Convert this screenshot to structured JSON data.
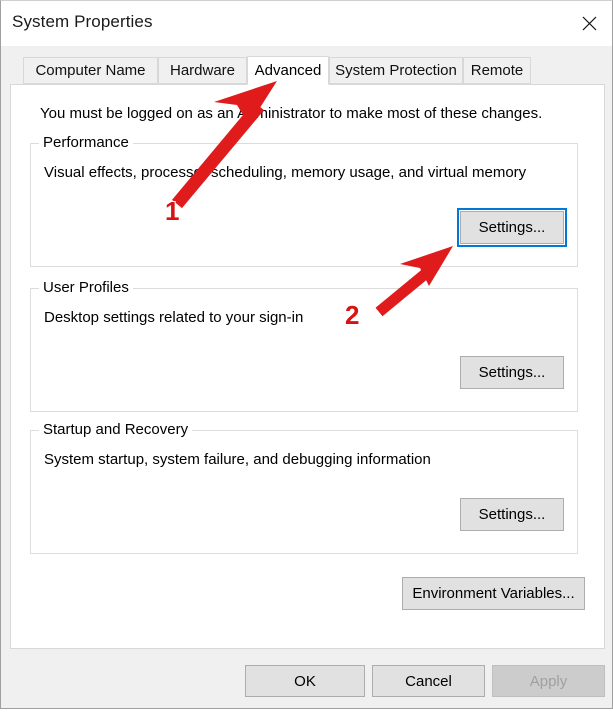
{
  "window": {
    "title": "System Properties",
    "close_icon": "close-icon"
  },
  "tabs": [
    {
      "label": "Computer Name",
      "selected": false
    },
    {
      "label": "Hardware",
      "selected": false
    },
    {
      "label": "Advanced",
      "selected": true
    },
    {
      "label": "System Protection",
      "selected": false
    },
    {
      "label": "Remote",
      "selected": false
    }
  ],
  "content": {
    "intro": "You must be logged on as an Administrator to make most of these changes.",
    "groups": [
      {
        "label": "Performance",
        "description": "Visual effects, processor scheduling, memory usage, and virtual memory",
        "button": "Settings..."
      },
      {
        "label": "User Profiles",
        "description": "Desktop settings related to your sign-in",
        "button": "Settings..."
      },
      {
        "label": "Startup and Recovery",
        "description": "System startup, system failure, and debugging information",
        "button": "Settings..."
      }
    ],
    "env_button": "Environment Variables..."
  },
  "footer": {
    "ok": "OK",
    "cancel": "Cancel",
    "apply": "Apply"
  },
  "annotations": {
    "arrow_color": "#e01b1b",
    "markers": [
      {
        "number": "1"
      },
      {
        "number": "2"
      }
    ]
  },
  "colors": {
    "accent": "#0078d7",
    "annotation_red": "#e01b1b",
    "window_bg": "#f0f0f0",
    "panel_bg": "#ffffff",
    "button_bg": "#e1e1e1"
  }
}
